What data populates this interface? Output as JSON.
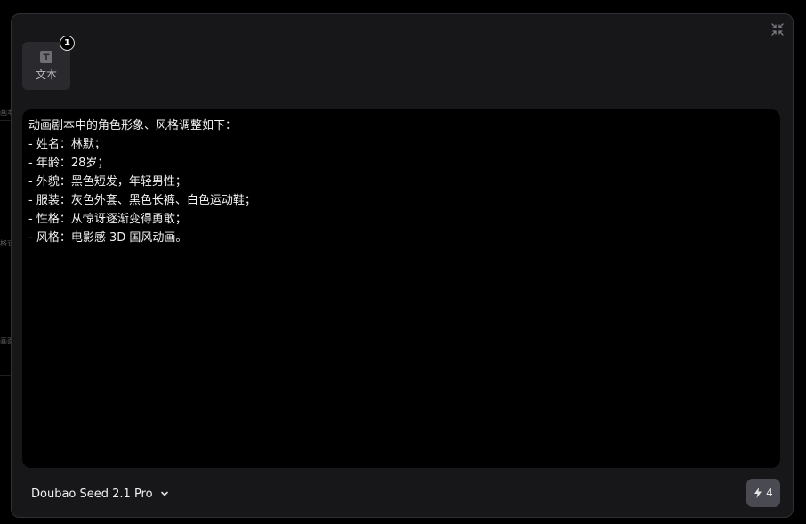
{
  "attachment": {
    "label": "文本",
    "count": "1",
    "icon": "text-t-icon"
  },
  "prompt": {
    "lines": [
      "动画剧本中的角色形象、风格调整如下：",
      "- 姓名：林默；",
      "- 年龄：28岁；",
      "- 外貌：黑色短发，年轻男性；",
      "- 服装：灰色外套、黑色长裤、白色运动鞋；",
      "- 性格：从惊讶逐渐变得勇敢；",
      "- 风格：电影感 3D 国风动画。"
    ]
  },
  "footer": {
    "model_name": "Doubao Seed 2.1 Pro",
    "cost": "4",
    "cost_icon": "lightning-icon"
  },
  "background_fragments": [
    "画本",
    "格式",
    "画面"
  ],
  "colors": {
    "modal_bg": "#17171a",
    "prompt_bg": "#000000",
    "send_button_bg": "#4a4a52",
    "attach_card_bg": "#2a2a2e"
  }
}
